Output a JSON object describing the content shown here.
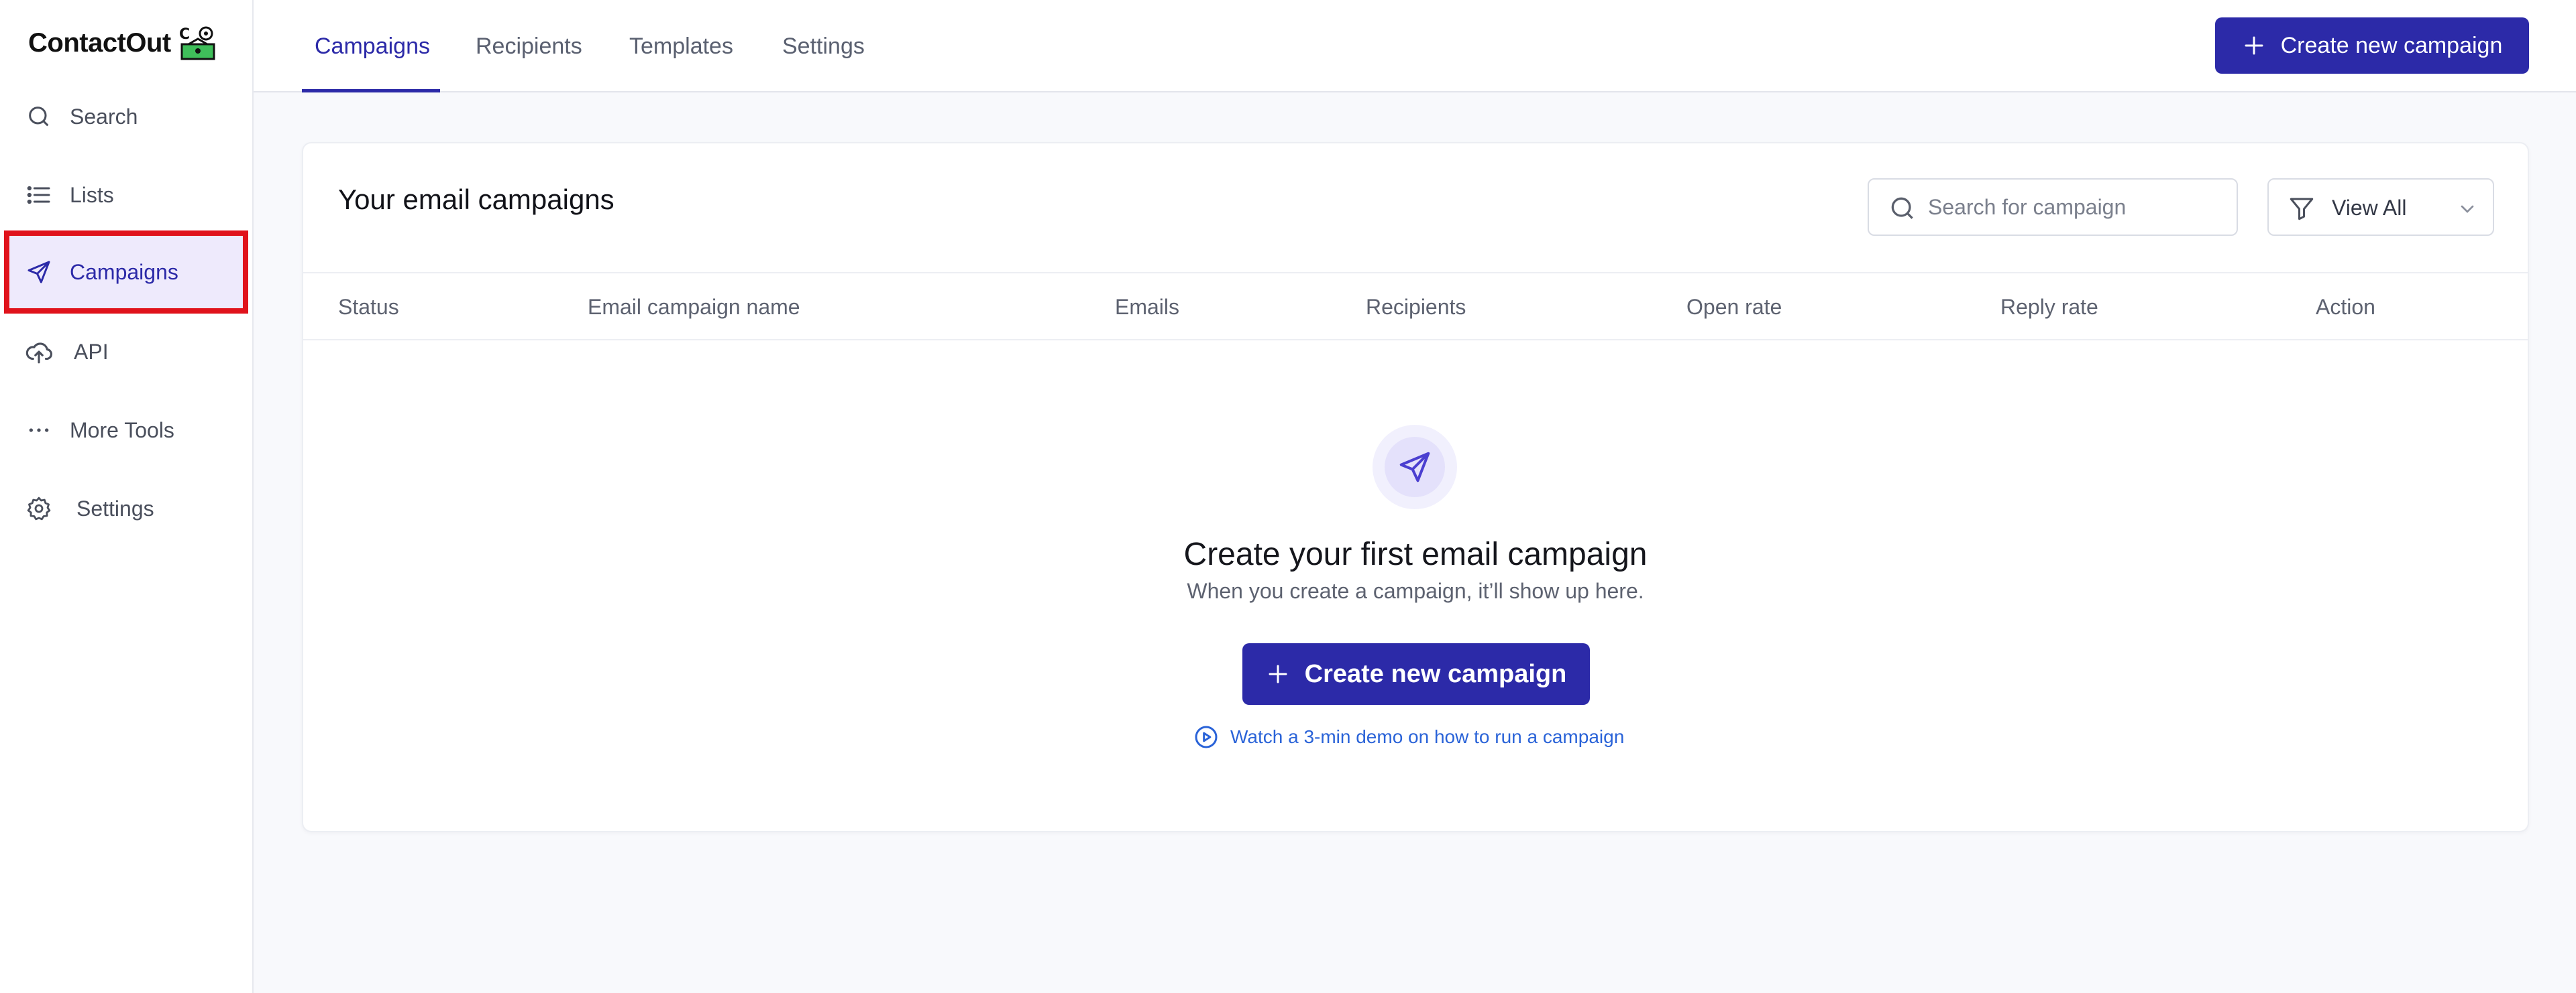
{
  "brand": {
    "name": "ContactOut",
    "accent": "#2c2aa8",
    "highlight": "#e0131c"
  },
  "sidebar": {
    "items": [
      {
        "label": "Search",
        "icon": "search-icon"
      },
      {
        "label": "Lists",
        "icon": "list-icon"
      },
      {
        "label": "Campaigns",
        "icon": "send-icon",
        "active": true
      },
      {
        "label": "API",
        "icon": "cloud-upload-icon"
      },
      {
        "label": "More Tools",
        "icon": "more-horizontal-icon"
      },
      {
        "label": "Settings",
        "icon": "gear-icon"
      }
    ]
  },
  "topbar": {
    "tabs": [
      {
        "label": "Campaigns",
        "active": true
      },
      {
        "label": "Recipients"
      },
      {
        "label": "Templates"
      },
      {
        "label": "Settings"
      }
    ],
    "create_button": "Create new campaign"
  },
  "campaigns": {
    "title": "Your email campaigns",
    "search_placeholder": "Search for campaign",
    "filter_label": "View All",
    "columns": [
      "Status",
      "Email campaign name",
      "Emails",
      "Recipients",
      "Open rate",
      "Reply rate",
      "Action"
    ],
    "empty": {
      "title": "Create your first email campaign",
      "subtitle": "When you create a campaign, it’ll show up here.",
      "button": "Create new campaign",
      "demo_link": "Watch a 3-min demo on how to run a campaign"
    }
  }
}
